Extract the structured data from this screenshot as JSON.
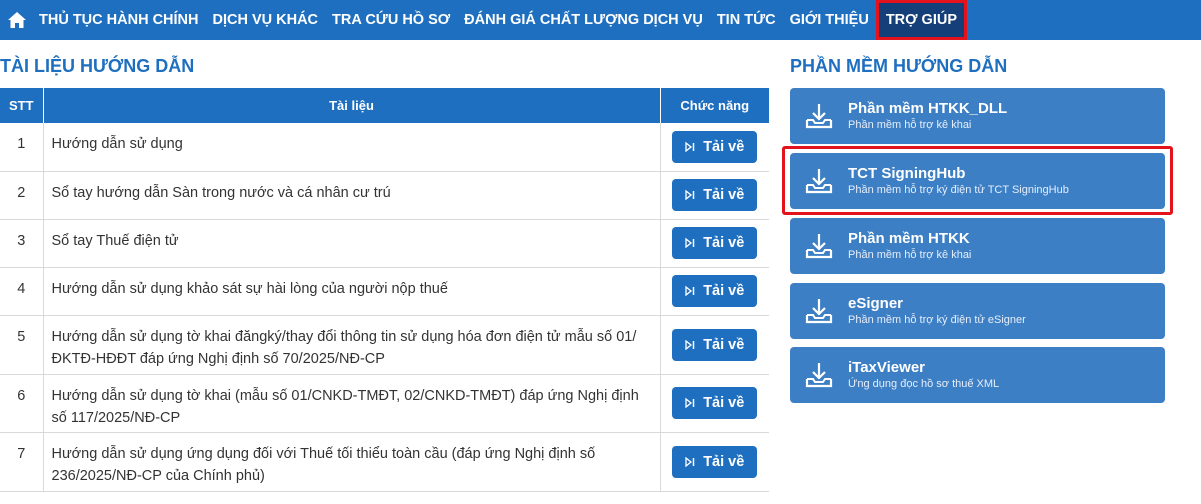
{
  "nav": {
    "items": [
      {
        "label": "THỦ TỤC HÀNH CHÍNH"
      },
      {
        "label": "DỊCH VỤ KHÁC"
      },
      {
        "label": "TRA CỨU HỒ SƠ"
      },
      {
        "label": "ĐÁNH GIÁ CHẤT LƯỢNG DỊCH VỤ"
      },
      {
        "label": "TIN TỨC"
      },
      {
        "label": "GIỚI THIỆU"
      },
      {
        "label": "TRỢ GIÚP"
      }
    ]
  },
  "documents": {
    "title": "TÀI LIỆU HƯỚNG DẪN",
    "columns": {
      "stt": "STT",
      "doc": "Tài liệu",
      "fn": "Chức năng"
    },
    "download_label": "Tải về",
    "rows": [
      {
        "stt": "1",
        "name": "Hướng dẫn sử dụng"
      },
      {
        "stt": "2",
        "name": "Sổ tay hướng dẫn Sàn trong nước và cá nhân cư trú"
      },
      {
        "stt": "3",
        "name": "Sổ tay Thuế điện tử"
      },
      {
        "stt": "4",
        "name": "Hướng dẫn sử dụng khảo sát sự hài lòng của người nộp thuế"
      },
      {
        "stt": "5",
        "name": "Hướng dẫn sử dụng tờ khai đăngký/thay đổi thông tin sử dụng hóa đơn điện tử mẫu số 01/ĐKTĐ-HĐĐT đáp ứng Nghị định số 70/2025/NĐ-CP"
      },
      {
        "stt": "6",
        "name": "Hướng dẫn sử dụng tờ khai (mẫu số 01/CNKD-TMĐT, 02/CNKD-TMĐT) đáp ứng Nghị định số 117/2025/NĐ-CP"
      },
      {
        "stt": "7",
        "name": "Hướng dẫn sử dụng ứng dụng đối với Thuế tối thiểu toàn cầu (đáp ứng Nghị định số 236/2025/NĐ-CP của Chính phủ)"
      }
    ]
  },
  "software": {
    "title": "PHẦN MỀM HƯỚNG DẪN",
    "items": [
      {
        "title": "Phần mềm HTKK_DLL",
        "subtitle": "Phần mềm hỗ trợ kê khai"
      },
      {
        "title": "TCT SigningHub",
        "subtitle": "Phần mềm hỗ trợ ký điện tử TCT SigningHub"
      },
      {
        "title": "Phần mềm HTKK",
        "subtitle": "Phần mềm hỗ trợ kê khai"
      },
      {
        "title": "eSigner",
        "subtitle": "Phần mềm hỗ trợ ký điện tử eSigner"
      },
      {
        "title": "iTaxViewer",
        "subtitle": "Ứng dụng đọc hồ sơ thuế XML"
      }
    ]
  },
  "colors": {
    "primary": "#1f6fc0",
    "active_nav": "#143f78",
    "highlight": "#e3121b",
    "card": "#3d7fc4"
  }
}
